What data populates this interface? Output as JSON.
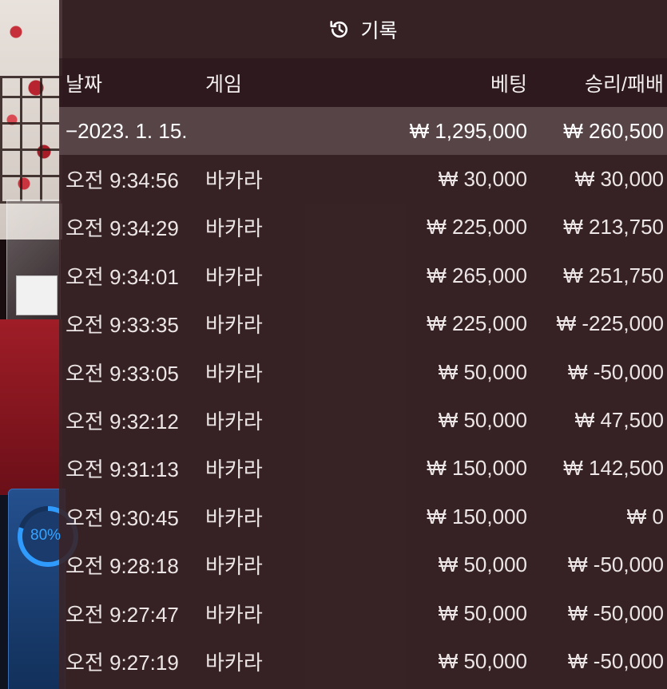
{
  "header": {
    "title": "기록",
    "icon": "history-icon"
  },
  "columns": {
    "date": "날짜",
    "game": "게임",
    "bet": "베팅",
    "result": "승리/패배"
  },
  "summary": {
    "date": "−2023. 1. 15.",
    "bet": "₩ 1,295,000",
    "result": "₩ 260,500"
  },
  "rows": [
    {
      "time": "오전 9:34:56",
      "game": "바카라",
      "bet": "₩ 30,000",
      "result": "₩ 30,000"
    },
    {
      "time": "오전 9:34:29",
      "game": "바카라",
      "bet": "₩ 225,000",
      "result": "₩ 213,750"
    },
    {
      "time": "오전 9:34:01",
      "game": "바카라",
      "bet": "₩ 265,000",
      "result": "₩ 251,750"
    },
    {
      "time": "오전 9:33:35",
      "game": "바카라",
      "bet": "₩ 225,000",
      "result": "₩ -225,000"
    },
    {
      "time": "오전 9:33:05",
      "game": "바카라",
      "bet": "₩ 50,000",
      "result": "₩ -50,000"
    },
    {
      "time": "오전 9:32:12",
      "game": "바카라",
      "bet": "₩ 50,000",
      "result": "₩ 47,500"
    },
    {
      "time": "오전 9:31:13",
      "game": "바카라",
      "bet": "₩ 150,000",
      "result": "₩ 142,500"
    },
    {
      "time": "오전 9:30:45",
      "game": "바카라",
      "bet": "₩ 150,000",
      "result": "₩ 0"
    },
    {
      "time": "오전 9:28:18",
      "game": "바카라",
      "bet": "₩ 50,000",
      "result": "₩ -50,000"
    },
    {
      "time": "오전 9:27:47",
      "game": "바카라",
      "bet": "₩ 50,000",
      "result": "₩ -50,000"
    },
    {
      "time": "오전 9:27:19",
      "game": "바카라",
      "bet": "₩ 50,000",
      "result": "₩ -50,000"
    }
  ],
  "background": {
    "progress_label": "80%",
    "progress_value": 0.8,
    "accent": "#2f9bff"
  }
}
